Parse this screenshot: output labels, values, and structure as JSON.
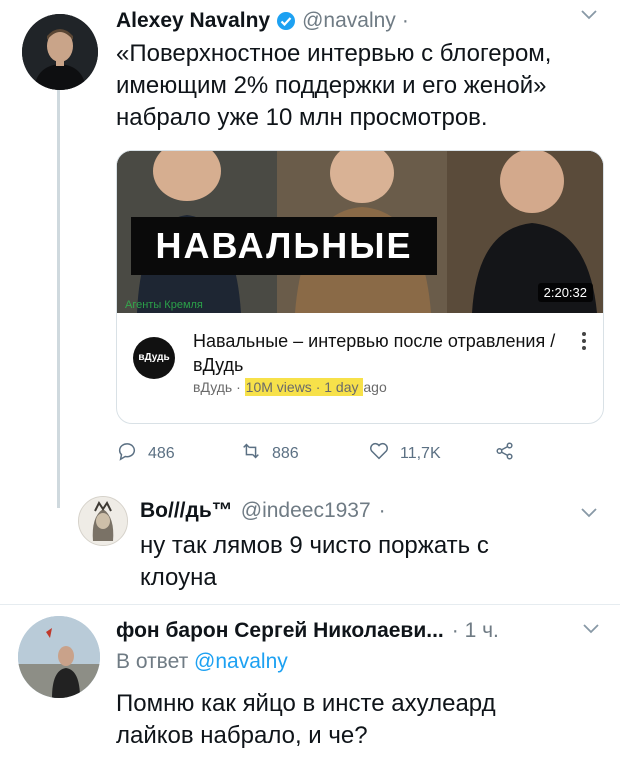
{
  "tweet": {
    "author_name": "Alexey Navalny",
    "handle": "@navalny",
    "dot": "·",
    "text": "«Поверхностное интервью с блогером, имеющим 2% поддержки и его женой» набрало уже 10 млн просмотров.",
    "verified": true,
    "card": {
      "banner_text": "НАВАЛЬНЫЕ",
      "duration": "2:20:32",
      "watermark": "Агенты Кремля",
      "channel_logo": "вДудь",
      "title": "Навальные – интервью после отравления / вДудь",
      "meta_channel": "вДудь · ",
      "meta_views": "10M views · 1 day ",
      "meta_tail": "ago"
    },
    "actions": {
      "replies": "486",
      "retweets": "886",
      "likes": "11,7K"
    }
  },
  "reply1": {
    "author_name": "Во///дь™",
    "handle": "@indeec1937",
    "dot": "·",
    "text": "ну так лямов 9 чисто поржать с клоуна"
  },
  "reply2": {
    "author_name": "фон барон Сергей Николаеви...",
    "time": "· 1 ч.",
    "reply_to_prefix": "В ответ ",
    "reply_to_handle": "@navalny",
    "text": "Помню как яйцо в инсте ахулеард лайков набрало, и че?"
  },
  "icons": {
    "reply": "comment-icon",
    "retweet": "retweet-icon",
    "like": "heart-icon",
    "share": "share-icon",
    "verified": "verified-badge-icon",
    "more": "chevron-down-icon"
  },
  "colors": {
    "accent": "#1da1f2",
    "muted": "#6f7b84",
    "highlight": "#f7e14a"
  }
}
